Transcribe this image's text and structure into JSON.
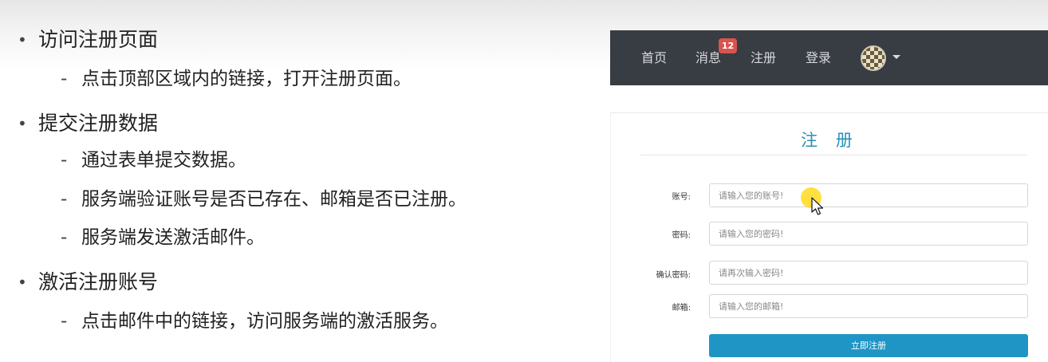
{
  "slide": {
    "sections": [
      {
        "title": "访问注册页面",
        "details": [
          "点击顶部区域内的链接，打开注册页面。"
        ]
      },
      {
        "title": "提交注册数据",
        "details": [
          "通过表单提交数据。",
          "服务端验证账号是否已存在、邮箱是否已注册。",
          "服务端发送激活邮件。"
        ]
      },
      {
        "title": "激活注册账号",
        "details": [
          "点击邮件中的链接，访问服务端的激活服务。"
        ]
      }
    ],
    "bullet_glyph": "•",
    "dash_glyph": "-"
  },
  "web": {
    "nav": {
      "home": "首页",
      "messages": "消息",
      "messages_badge": "12",
      "register": "注册",
      "login": "登录"
    },
    "form": {
      "title": "注 册",
      "fields": [
        {
          "label": "账号:",
          "placeholder": "请输入您的账号!"
        },
        {
          "label": "密码:",
          "placeholder": "请输入您的密码!"
        },
        {
          "label": "确认密码:",
          "placeholder": "请再次输入密码!"
        },
        {
          "label": "邮箱:",
          "placeholder": "请输入您的邮箱!"
        }
      ],
      "submit_label": "立即注册"
    }
  },
  "colors": {
    "navbar_bg": "#383c43",
    "accent": "#1f95c5",
    "badge": "#d9534f",
    "title": "#2a8fb8"
  }
}
